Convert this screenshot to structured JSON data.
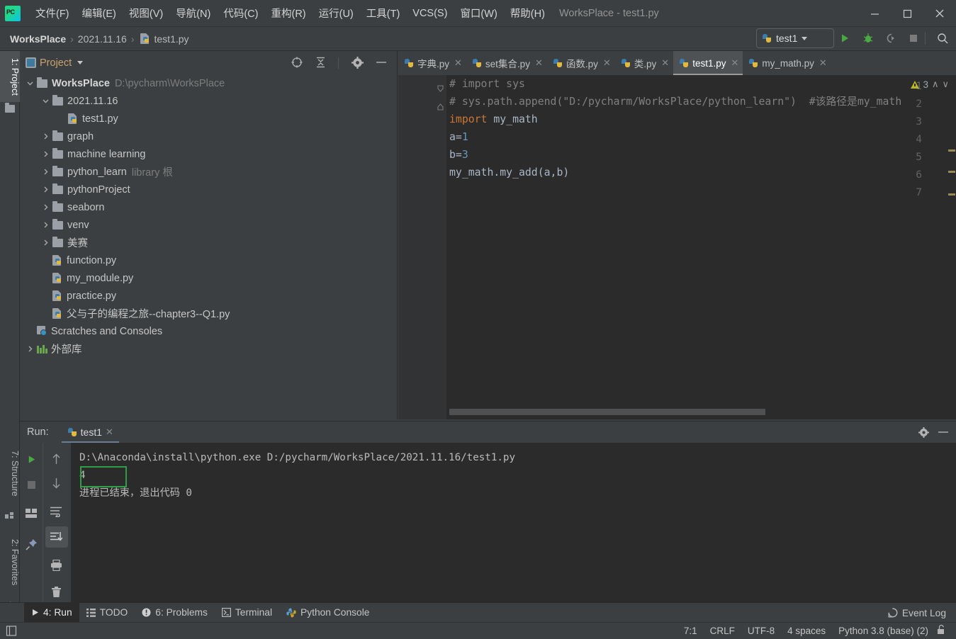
{
  "window": {
    "title": "WorksPlace - test1.py",
    "minimize_label": "minimize",
    "maximize_label": "maximize",
    "close_label": "close"
  },
  "menubar": {
    "items": [
      {
        "text": "文件(F)",
        "mnemonic": "F"
      },
      {
        "text": "编辑(E)",
        "mnemonic": "E"
      },
      {
        "text": "视图(V)",
        "mnemonic": "V"
      },
      {
        "text": "导航(N)",
        "mnemonic": "N"
      },
      {
        "text": "代码(C)",
        "mnemonic": "C"
      },
      {
        "text": "重构(R)",
        "mnemonic": "R"
      },
      {
        "text": "运行(U)",
        "mnemonic": "U"
      },
      {
        "text": "工具(T)",
        "mnemonic": "T"
      },
      {
        "text": "VCS(S)",
        "mnemonic": "S"
      },
      {
        "text": "窗口(W)",
        "mnemonic": "W"
      },
      {
        "text": "帮助(H)",
        "mnemonic": "H"
      }
    ]
  },
  "navbar": {
    "breadcrumbs": [
      "WorksPlace",
      "2021.11.16",
      "test1.py"
    ],
    "separator": "›",
    "run_config": "test1",
    "buttons": [
      "run-button",
      "debug-button",
      "run-coverage-button",
      "stop-button",
      "search-everywhere-button"
    ]
  },
  "left_tool_strip": {
    "tabs": [
      {
        "label": "1: Project",
        "selected": true
      },
      {
        "label": "7: Structure",
        "selected": false
      },
      {
        "label": "2: Favorites",
        "selected": false
      }
    ]
  },
  "project_panel": {
    "title": "Project",
    "toolbar": [
      "select-opened-file-icon",
      "collapse-all-icon",
      "settings-icon",
      "hide-icon"
    ],
    "tree": [
      {
        "indent": 0,
        "arrow": "down",
        "icon": "folder",
        "label": "WorksPlace",
        "bold": true,
        "sub": "D:\\pycharm\\WorksPlace"
      },
      {
        "indent": 1,
        "arrow": "down",
        "icon": "folder",
        "label": "2021.11.16",
        "bold": false,
        "sub": ""
      },
      {
        "indent": 2,
        "arrow": "none",
        "icon": "python",
        "label": "test1.py",
        "bold": false,
        "sub": ""
      },
      {
        "indent": 1,
        "arrow": "right",
        "icon": "folder",
        "label": "graph",
        "bold": false,
        "sub": ""
      },
      {
        "indent": 1,
        "arrow": "right",
        "icon": "folder",
        "label": "machine learning",
        "bold": false,
        "sub": ""
      },
      {
        "indent": 1,
        "arrow": "right",
        "icon": "folder",
        "label": "python_learn",
        "bold": false,
        "sub": "library 根"
      },
      {
        "indent": 1,
        "arrow": "right",
        "icon": "folder",
        "label": "pythonProject",
        "bold": false,
        "sub": ""
      },
      {
        "indent": 1,
        "arrow": "right",
        "icon": "folder",
        "label": "seaborn",
        "bold": false,
        "sub": ""
      },
      {
        "indent": 1,
        "arrow": "right",
        "icon": "folder",
        "label": "venv",
        "bold": false,
        "sub": ""
      },
      {
        "indent": 1,
        "arrow": "right",
        "icon": "folder",
        "label": "美赛",
        "bold": false,
        "sub": ""
      },
      {
        "indent": 1,
        "arrow": "none",
        "icon": "python",
        "label": "function.py",
        "bold": false,
        "sub": ""
      },
      {
        "indent": 1,
        "arrow": "none",
        "icon": "python",
        "label": "my_module.py",
        "bold": false,
        "sub": ""
      },
      {
        "indent": 1,
        "arrow": "none",
        "icon": "python",
        "label": "practice.py",
        "bold": false,
        "sub": ""
      },
      {
        "indent": 1,
        "arrow": "none",
        "icon": "python",
        "label": "父与子的编程之旅--chapter3--Q1.py",
        "bold": false,
        "sub": ""
      },
      {
        "indent": 0,
        "arrow": "none",
        "icon": "scratch",
        "label": "Scratches and Consoles",
        "bold": false,
        "sub": ""
      },
      {
        "indent": 0,
        "arrow": "right",
        "icon": "library",
        "label": "外部库",
        "bold": false,
        "sub": ""
      }
    ]
  },
  "editor": {
    "tabs": [
      {
        "label": "字典.py",
        "active": false
      },
      {
        "label": "set集合.py",
        "active": false
      },
      {
        "label": "函数.py",
        "active": false
      },
      {
        "label": "类.py",
        "active": false
      },
      {
        "label": "test1.py",
        "active": true
      },
      {
        "label": "my_math.py",
        "active": false
      }
    ],
    "close_glyph": "✕",
    "inspection": {
      "warning_count": "3",
      "up_glyph": "∧",
      "down_glyph": "∨"
    },
    "line_numbers": [
      "1",
      "2",
      "3",
      "4",
      "5",
      "6",
      "7"
    ],
    "code": [
      {
        "line": 1,
        "tokens": [
          {
            "t": "# import sys",
            "c": "cmt"
          }
        ]
      },
      {
        "line": 2,
        "tokens": [
          {
            "t": "# sys.path.append(\"D:/pycharm/WorksPlace/python_learn\")  #该路径是my_math",
            "c": "cmt"
          }
        ]
      },
      {
        "line": 3,
        "tokens": [
          {
            "t": "import ",
            "c": "kw"
          },
          {
            "t": "my_math",
            "c": "plain"
          }
        ]
      },
      {
        "line": 4,
        "tokens": [
          {
            "t": "a",
            "c": "plain"
          },
          {
            "t": "=",
            "c": "plain"
          },
          {
            "t": "1",
            "c": "num"
          }
        ]
      },
      {
        "line": 5,
        "tokens": [
          {
            "t": "b",
            "c": "plain"
          },
          {
            "t": "=",
            "c": "plain"
          },
          {
            "t": "3",
            "c": "num"
          }
        ]
      },
      {
        "line": 6,
        "tokens": [
          {
            "t": "my_math.my_add(a,b)",
            "c": "plain"
          }
        ]
      },
      {
        "line": 7,
        "tokens": [
          {
            "t": "",
            "c": "plain"
          }
        ]
      }
    ]
  },
  "run_panel": {
    "label": "Run:",
    "tab": "test1",
    "close_glyph": "✕",
    "toolbar_left": [
      "rerun-button",
      "stop-button",
      "layout-button",
      "pin-tab-button"
    ],
    "toolbar_right": [
      "up-arrow-button",
      "down-arrow-button",
      "soft-wrap-button",
      "scroll-to-end-button",
      "print-button",
      "clear-all-button"
    ],
    "header_controls": [
      "settings-icon",
      "hide-icon"
    ],
    "console_lines": [
      "D:\\Anaconda\\install\\python.exe D:/pycharm/WorksPlace/2021.11.16/test1.py",
      "4",
      "",
      "进程已结束，退出代码 0"
    ],
    "highlight_color": "#2f9e44"
  },
  "bottom_bar": {
    "items": [
      {
        "label": "4: Run",
        "icon": "run-icon",
        "selected": true
      },
      {
        "label": "TODO",
        "icon": "todo-icon",
        "selected": false
      },
      {
        "label": "6: Problems",
        "icon": "problems-icon",
        "selected": false
      },
      {
        "label": "Terminal",
        "icon": "terminal-icon",
        "selected": false
      },
      {
        "label": "Python Console",
        "icon": "python-console-icon",
        "selected": false
      }
    ],
    "event_log": "Event Log"
  },
  "status_bar": {
    "caret": "7:1",
    "line_separator": "CRLF",
    "encoding": "UTF-8",
    "indent": "4 spaces",
    "interpreter": "Python 3.8 (base) (2)",
    "lock_icon": "unlocked-icon"
  }
}
